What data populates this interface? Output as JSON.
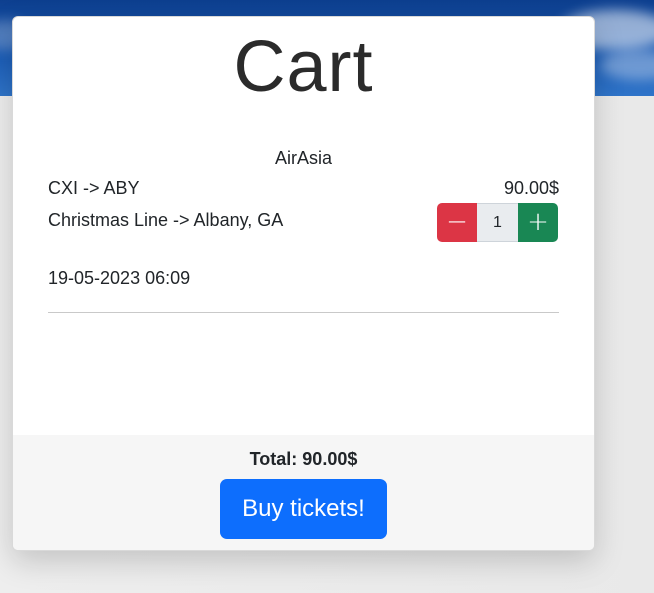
{
  "cart": {
    "title": "Cart",
    "items": [
      {
        "airline": "AirAsia",
        "route": "CXI -> ABY",
        "price": "90.00$",
        "stations": "Christmas Line -> Albany, GA",
        "datetime": "19-05-2023 06:09",
        "quantity": "1",
        "decrement_label": "−",
        "increment_label": "+"
      }
    ],
    "total_label": "Total: 90.00$",
    "buy_label": "Buy tickets!"
  },
  "colors": {
    "primary": "#0d6efd",
    "danger": "#dc3545",
    "success": "#198754"
  }
}
